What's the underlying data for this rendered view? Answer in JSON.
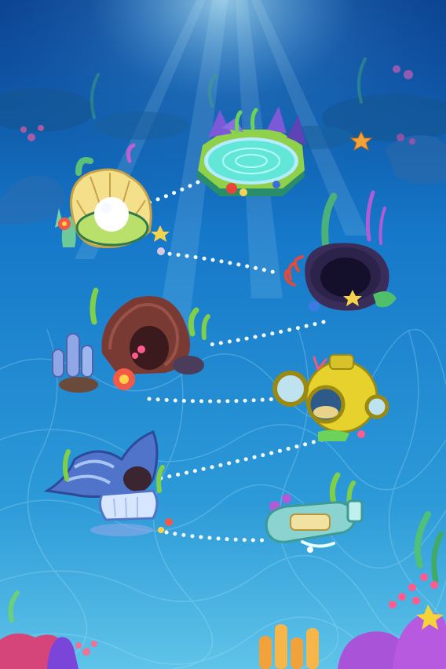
{
  "scene": {
    "type": "underwater level map",
    "colors": {
      "water_top": "#0a3f8e",
      "water_mid": "#1678c9",
      "water_bottom": "#5fc4e8",
      "path_dots": "#ffffff",
      "pool": "#62e6d8",
      "pearl_shell": "#f4e08a",
      "shell_cave": "#5a2f2b",
      "sunken_drum": "#2c234a",
      "diving_helmet": "#e7d12c",
      "conch_shell": "#4f74c9",
      "bottle": "#8fd6d0"
    }
  },
  "levels": [
    {
      "id": 1,
      "landmark": "coral-pool-icon",
      "state": "available"
    },
    {
      "id": 2,
      "landmark": "pearl-oyster-icon",
      "state": "available"
    },
    {
      "id": 3,
      "landmark": "stone-barrel-cave-icon",
      "state": "available"
    },
    {
      "id": 4,
      "landmark": "rock-cave-icon",
      "state": "available"
    },
    {
      "id": 5,
      "landmark": "diving-helmet-icon",
      "state": "available"
    },
    {
      "id": 6,
      "landmark": "conch-shell-house-icon",
      "state": "available"
    },
    {
      "id": 7,
      "landmark": "message-bottle-icon",
      "state": "available"
    }
  ]
}
